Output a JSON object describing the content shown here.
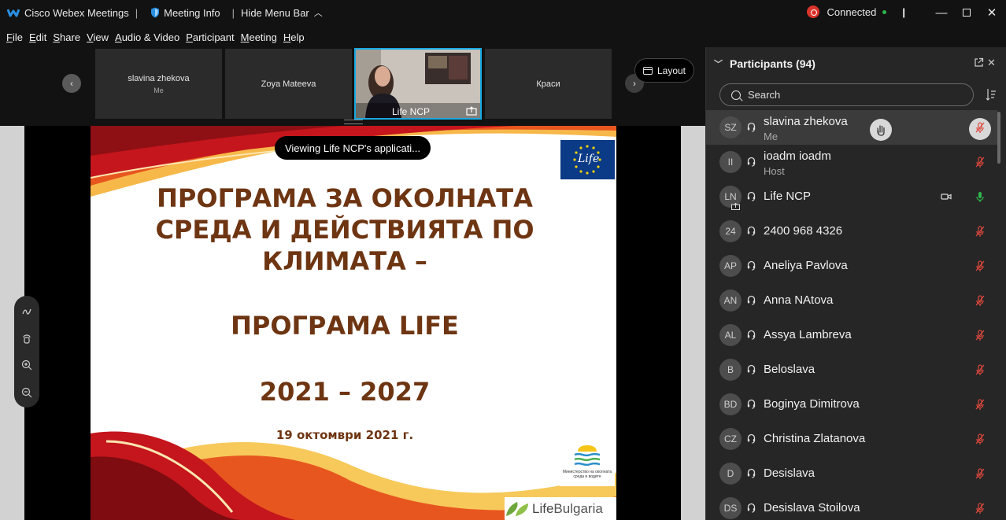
{
  "app": {
    "title": "Cisco Webex Meetings",
    "meeting_info": "Meeting Info",
    "hide_menu_bar": "Hide Menu Bar",
    "status": "Connected",
    "brand_color": "#17a9e0"
  },
  "menu": [
    "File",
    "Edit",
    "Share",
    "View",
    "Audio & Video",
    "Participant",
    "Meeting",
    "Help"
  ],
  "video_strip": {
    "tiles": [
      {
        "name": "slavina zhekova",
        "sub": "Me"
      },
      {
        "name": "Zoya Mateeva",
        "sub": ""
      },
      {
        "name": "Life NCP",
        "sub": ""
      },
      {
        "name": "Краси",
        "sub": ""
      }
    ],
    "layout_label": "Layout"
  },
  "share": {
    "toast": "Viewing Life NCP's applicati...",
    "slide_title_1": "ПРОГРАМА ЗА ОКОЛНАТА",
    "slide_title_2": "СРЕДА И ДЕЙСТВИЯТА ПО",
    "slide_title_3": "КЛИМАТА –",
    "slide_title_4": "ПРОГРАМА LIFE",
    "slide_years": "2021 – 2027",
    "slide_date": "19 октомври 2021 г.",
    "logo_life": "Life",
    "ministry_text": "Министерство на околната среда и водите",
    "footer_logo_a": "Life",
    "footer_logo_b": "Bulgaria",
    "title_color": "#6e3512"
  },
  "participants": {
    "header": "Participants (94)",
    "search_placeholder": "Search",
    "list": [
      {
        "initials": "SZ",
        "name": "slavina zhekova",
        "role": "Me"
      },
      {
        "initials": "II",
        "name": "ioadm ioadm",
        "role": "Host"
      },
      {
        "initials": "LN",
        "name": "Life NCP",
        "role": ""
      },
      {
        "initials": "24",
        "name": "2400 968 4326",
        "role": ""
      },
      {
        "initials": "AP",
        "name": "Aneliya Pavlova",
        "role": ""
      },
      {
        "initials": "AN",
        "name": "Anna NAtova",
        "role": ""
      },
      {
        "initials": "AL",
        "name": "Assya Lambreva",
        "role": ""
      },
      {
        "initials": "B",
        "name": "Beloslava",
        "role": ""
      },
      {
        "initials": "BD",
        "name": "Boginya Dimitrova",
        "role": ""
      },
      {
        "initials": "CZ",
        "name": "Christina Zlatanova",
        "role": ""
      },
      {
        "initials": "D",
        "name": "Desislava",
        "role": ""
      },
      {
        "initials": "DS",
        "name": "Desislava Stoilova",
        "role": ""
      }
    ]
  }
}
